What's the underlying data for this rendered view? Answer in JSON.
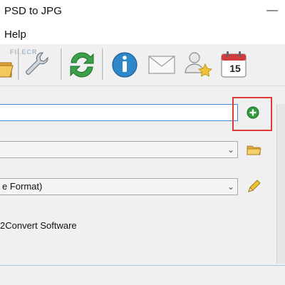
{
  "window": {
    "title": "PSD to JPG",
    "minimize_glyph": "—"
  },
  "menu": {
    "help_label": "Help"
  },
  "toolbar": {
    "watermark": "FILECR",
    "icons": [
      "folder-open-icon",
      "wrench-icon",
      "refresh-icon",
      "info-icon",
      "envelope-icon",
      "user-star-icon",
      "calendar-icon"
    ],
    "calendar_day": "15"
  },
  "form": {
    "source_value": "",
    "output_folder_value": "",
    "format_value": "e Format)",
    "software_text": "2Convert Software"
  },
  "colors": {
    "accent_blue": "#3c8de0",
    "add_green": "#2e9e3a",
    "highlight_red": "#e23a3a"
  }
}
